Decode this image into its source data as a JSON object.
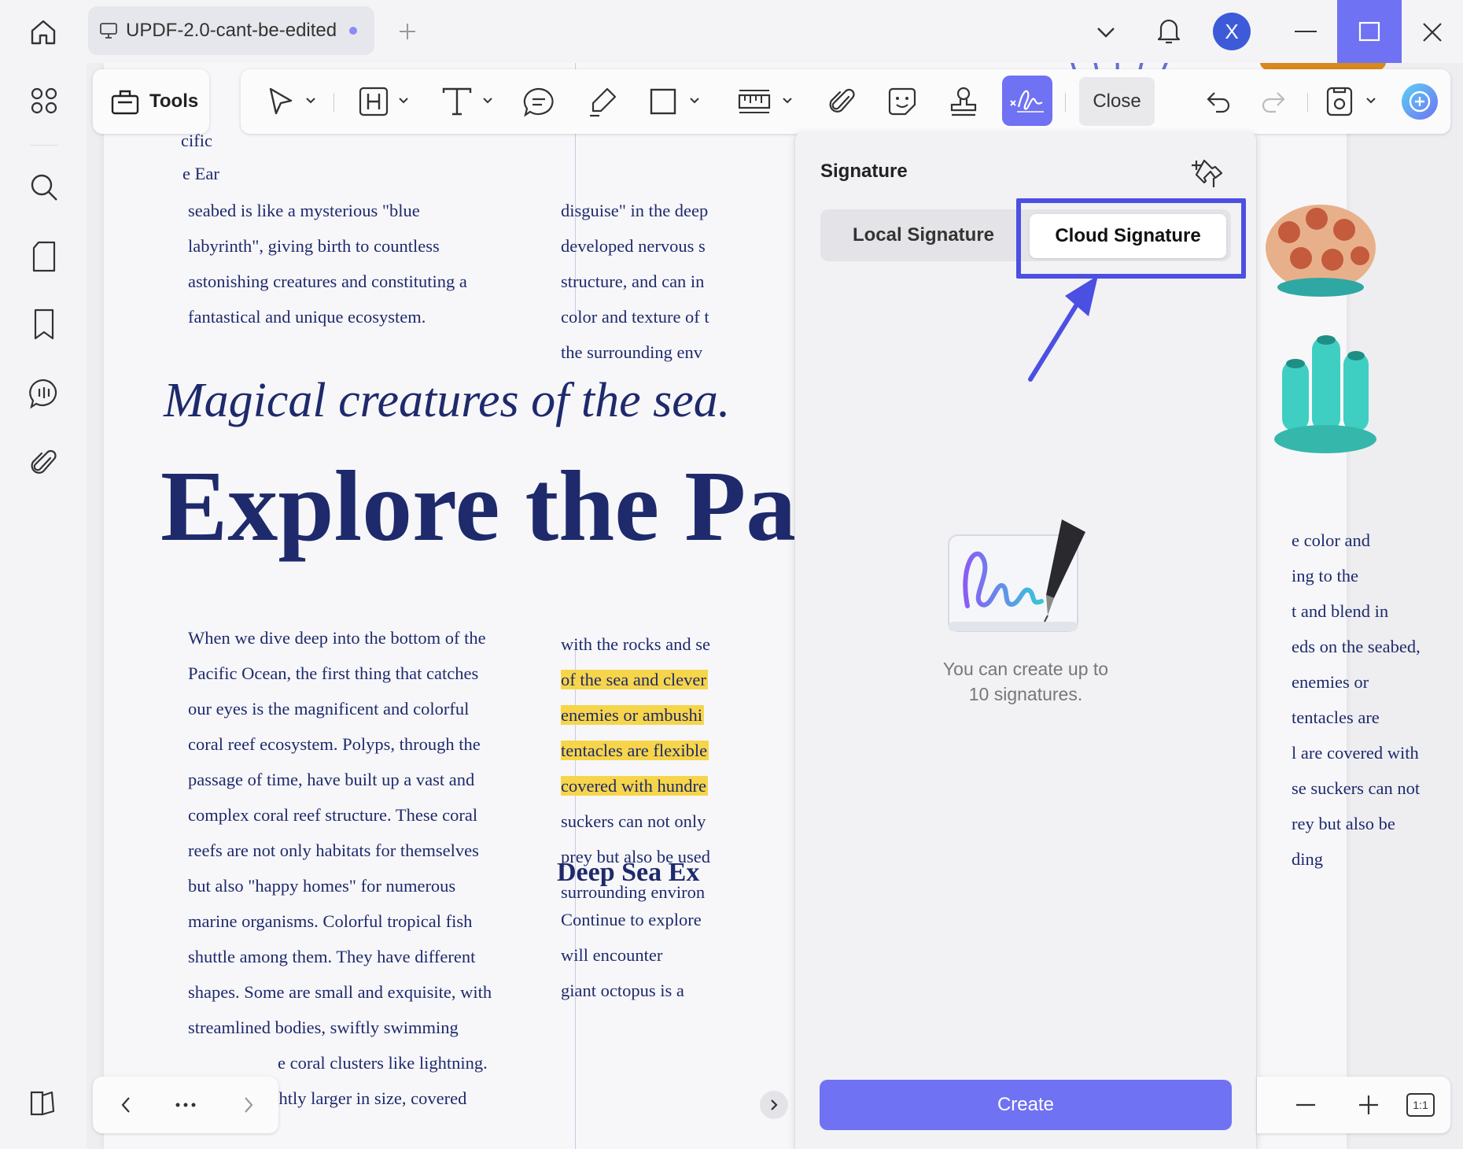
{
  "titlebar": {
    "tab_name": "UPDF-2.0-cant-be-edited",
    "avatar_letter": "X"
  },
  "toolbar": {
    "tools_label": "Tools",
    "close_label": "Close"
  },
  "document": {
    "col1_top": [
      "cific",
      "e Ear",
      "seabed is like a mysterious \"blue",
      "labyrinth\", giving birth to countless",
      "astonishing creatures and constituting a",
      "fantastical and unique ecosystem."
    ],
    "col2_top": [
      "disguise\" in the deep",
      "developed nervous s",
      "structure, and can in",
      "color and texture of t",
      "the surrounding env"
    ],
    "subtitle": "Magical creatures of the sea.",
    "heading": "Explore the Pa",
    "col1_body": [
      "When we dive deep into the bottom of the",
      "Pacific Ocean, the first thing that catches",
      "our eyes is the magnificent and colorful",
      "coral reef ecosystem. Polyps, through the",
      "passage of time, have built up a vast and",
      "complex coral reef structure. These coral",
      "reefs are not only habitats for themselves",
      "but also \"happy homes\" for numerous",
      "marine organisms. Colorful tropical fish",
      "shuttle among them. They have different",
      "shapes. Some are small and exquisite, with",
      "streamlined bodies, swiftly swimming",
      "e coral clusters like lightning.",
      "ightly larger in size, covered"
    ],
    "col2_body": [
      "with the rocks and se",
      "of the sea and clever",
      "enemies or ambushi",
      "tentacles are flexible",
      "covered with hundre",
      "suckers can not only",
      "prey but also be used",
      "surrounding environ"
    ],
    "deep_sea_heading": "Deep Sea Ex",
    "col2_deep": [
      "Continue to explore",
      "will encounter",
      "giant octopus is a"
    ],
    "col3_body": [
      "e color and",
      "ing to the",
      "t and blend in",
      "eds on the seabed,",
      "enemies or",
      "tentacles are",
      "l are covered with",
      "se suckers can not",
      "rey but also be",
      "ding"
    ]
  },
  "signature_panel": {
    "title": "Signature",
    "local_tab": "Local Signature",
    "cloud_tab": "Cloud Signature",
    "empty_line1": "You can create up to",
    "empty_line2": "10 signatures.",
    "create_label": "Create"
  },
  "zoom": {
    "fit_label": "1:1"
  },
  "colors": {
    "accent": "#6f72f2",
    "highlight_box": "#4b4fe2",
    "text_navy": "#1e2a6b",
    "text_highlight": "#f7d54a"
  }
}
